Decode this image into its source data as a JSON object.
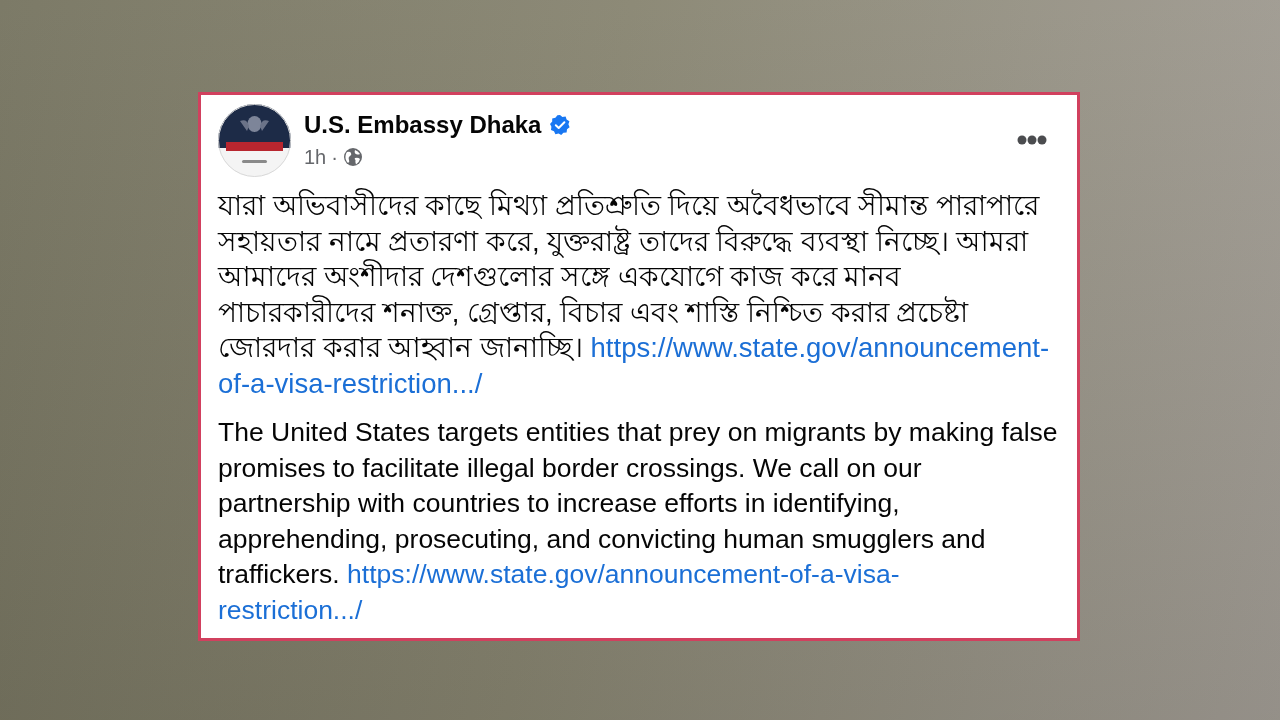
{
  "post": {
    "author": {
      "name": "U.S. Embassy Dhaka",
      "verified": true
    },
    "time": "1h",
    "separator": "·",
    "paragraphs": [
      {
        "kind": "bengali",
        "text": "যারা অভিবাসীদের কাছে মিথ্যা প্রতিশ্রুতি দিয়ে অবৈধভাবে সীমান্ত পারাপারে সহায়তার নামে প্রতারণা করে, যুক্তরাষ্ট্র তাদের বিরুদ্ধে ব্যবস্থা নিচ্ছে। আমরা আমাদের অংশীদার দেশগুলোর সঙ্গে একযোগে কাজ করে মানব পাচারকারীদের শনাক্ত, গ্রেপ্তার, বিচার এবং শাস্তি নিশ্চিত করার প্রচেষ্টা জোরদার করার আহ্বান জানাচ্ছি।",
        "link_parts": [
          "https://www.state.gov/announcement-",
          "of-a-visa-restriction.../"
        ]
      },
      {
        "kind": "english",
        "text": "The United States targets entities that prey on migrants by making false promises to facilitate illegal border crossings. We call on our partnership with countries to increase efforts in identifying, apprehending, prosecuting, and convicting human smugglers and traffickers.",
        "link_parts": [
          "https://www.state.gov/announcement-of-a-visa-",
          "restriction.../"
        ]
      }
    ]
  }
}
